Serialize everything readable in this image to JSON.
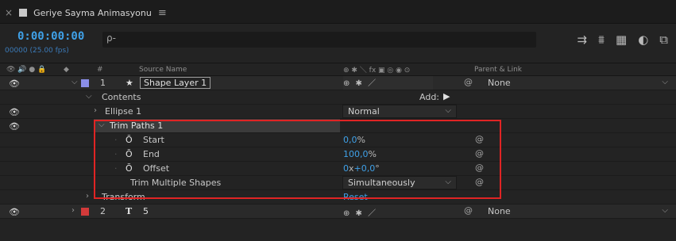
{
  "tab": {
    "close": "×",
    "title": "Geriye Sayma Animasyonu",
    "menu": "≡"
  },
  "header": {
    "timecode": "0:00:00:00",
    "frames": "00000 (25.00 fps)",
    "search_icon": "ρ-"
  },
  "columns": {
    "source_name": "Source Name",
    "parent_link": "Parent & Link",
    "number_sign": "#"
  },
  "rows": {
    "layer1": {
      "num": "1",
      "star": "★",
      "name": "Shape Layer 1",
      "parent": "None"
    },
    "contents": {
      "label": "Contents",
      "add": "Add:"
    },
    "ellipse": {
      "label": "Ellipse 1",
      "mode": "Normal"
    },
    "trim": {
      "label": "Trim Paths 1"
    },
    "start": {
      "label": "Start",
      "value": "0,0",
      "unit": "%"
    },
    "end": {
      "label": "End",
      "value": "100,0",
      "unit": "%"
    },
    "offset": {
      "label": "Offset",
      "value": "0",
      "unit": "x",
      "value2": "+0,0",
      "unit2": "°"
    },
    "trim_multi": {
      "label": "Trim Multiple Shapes",
      "value": "Simultaneously"
    },
    "transform": {
      "label": "Transform",
      "reset": "Reset"
    },
    "layer2": {
      "num": "2",
      "t": "T",
      "name": "5",
      "parent": "None"
    }
  },
  "colors": {
    "layer1_label": "#8a8ee8",
    "layer2_label": "#d23a3a",
    "accent": "#3fa1e8",
    "highlight": "#e02424"
  }
}
